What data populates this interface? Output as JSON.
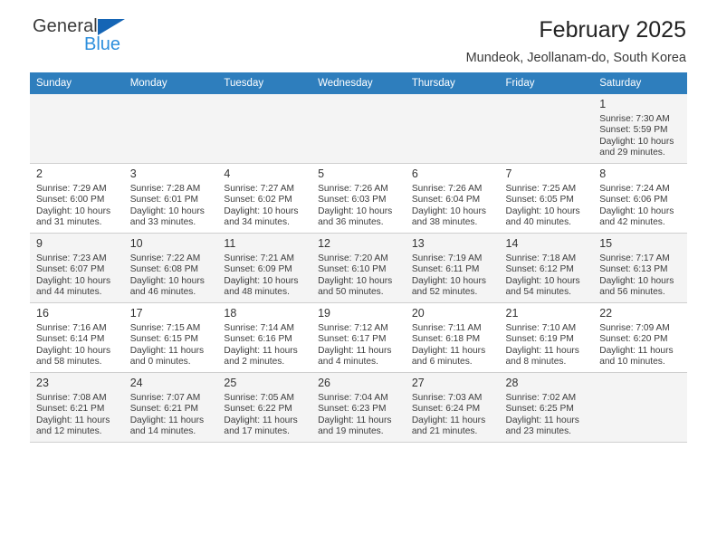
{
  "brand": {
    "name_top": "General",
    "name_bottom": "Blue",
    "triangle_icon": "brand-triangle-icon",
    "color_dark": "#3a3a3a",
    "color_blue": "#2d8fdd",
    "color_triangle": "#1565b5"
  },
  "header": {
    "title": "February 2025",
    "subtitle": "Mundeok, Jeollanam-do, South Korea"
  },
  "theme": {
    "header_row_bg": "#2e7ebd",
    "header_row_text": "#ffffff",
    "shaded_row_bg": "#f4f4f4",
    "grid_line": "#cfcfcf"
  },
  "calendar": {
    "weekday_headers": [
      "Sunday",
      "Monday",
      "Tuesday",
      "Wednesday",
      "Thursday",
      "Friday",
      "Saturday"
    ],
    "weeks": [
      {
        "shaded": true,
        "days": [
          {
            "date": "",
            "info": "",
            "empty": true
          },
          {
            "date": "",
            "info": "",
            "empty": true
          },
          {
            "date": "",
            "info": "",
            "empty": true
          },
          {
            "date": "",
            "info": "",
            "empty": true
          },
          {
            "date": "",
            "info": "",
            "empty": true
          },
          {
            "date": "",
            "info": "",
            "empty": true
          },
          {
            "date": "1",
            "info": "Sunrise: 7:30 AM\nSunset: 5:59 PM\nDaylight: 10 hours\nand 29 minutes.",
            "empty": false
          }
        ]
      },
      {
        "shaded": false,
        "days": [
          {
            "date": "2",
            "info": "Sunrise: 7:29 AM\nSunset: 6:00 PM\nDaylight: 10 hours\nand 31 minutes.",
            "empty": false
          },
          {
            "date": "3",
            "info": "Sunrise: 7:28 AM\nSunset: 6:01 PM\nDaylight: 10 hours\nand 33 minutes.",
            "empty": false
          },
          {
            "date": "4",
            "info": "Sunrise: 7:27 AM\nSunset: 6:02 PM\nDaylight: 10 hours\nand 34 minutes.",
            "empty": false
          },
          {
            "date": "5",
            "info": "Sunrise: 7:26 AM\nSunset: 6:03 PM\nDaylight: 10 hours\nand 36 minutes.",
            "empty": false
          },
          {
            "date": "6",
            "info": "Sunrise: 7:26 AM\nSunset: 6:04 PM\nDaylight: 10 hours\nand 38 minutes.",
            "empty": false
          },
          {
            "date": "7",
            "info": "Sunrise: 7:25 AM\nSunset: 6:05 PM\nDaylight: 10 hours\nand 40 minutes.",
            "empty": false
          },
          {
            "date": "8",
            "info": "Sunrise: 7:24 AM\nSunset: 6:06 PM\nDaylight: 10 hours\nand 42 minutes.",
            "empty": false
          }
        ]
      },
      {
        "shaded": true,
        "days": [
          {
            "date": "9",
            "info": "Sunrise: 7:23 AM\nSunset: 6:07 PM\nDaylight: 10 hours\nand 44 minutes.",
            "empty": false
          },
          {
            "date": "10",
            "info": "Sunrise: 7:22 AM\nSunset: 6:08 PM\nDaylight: 10 hours\nand 46 minutes.",
            "empty": false
          },
          {
            "date": "11",
            "info": "Sunrise: 7:21 AM\nSunset: 6:09 PM\nDaylight: 10 hours\nand 48 minutes.",
            "empty": false
          },
          {
            "date": "12",
            "info": "Sunrise: 7:20 AM\nSunset: 6:10 PM\nDaylight: 10 hours\nand 50 minutes.",
            "empty": false
          },
          {
            "date": "13",
            "info": "Sunrise: 7:19 AM\nSunset: 6:11 PM\nDaylight: 10 hours\nand 52 minutes.",
            "empty": false
          },
          {
            "date": "14",
            "info": "Sunrise: 7:18 AM\nSunset: 6:12 PM\nDaylight: 10 hours\nand 54 minutes.",
            "empty": false
          },
          {
            "date": "15",
            "info": "Sunrise: 7:17 AM\nSunset: 6:13 PM\nDaylight: 10 hours\nand 56 minutes.",
            "empty": false
          }
        ]
      },
      {
        "shaded": false,
        "days": [
          {
            "date": "16",
            "info": "Sunrise: 7:16 AM\nSunset: 6:14 PM\nDaylight: 10 hours\nand 58 minutes.",
            "empty": false
          },
          {
            "date": "17",
            "info": "Sunrise: 7:15 AM\nSunset: 6:15 PM\nDaylight: 11 hours\nand 0 minutes.",
            "empty": false
          },
          {
            "date": "18",
            "info": "Sunrise: 7:14 AM\nSunset: 6:16 PM\nDaylight: 11 hours\nand 2 minutes.",
            "empty": false
          },
          {
            "date": "19",
            "info": "Sunrise: 7:12 AM\nSunset: 6:17 PM\nDaylight: 11 hours\nand 4 minutes.",
            "empty": false
          },
          {
            "date": "20",
            "info": "Sunrise: 7:11 AM\nSunset: 6:18 PM\nDaylight: 11 hours\nand 6 minutes.",
            "empty": false
          },
          {
            "date": "21",
            "info": "Sunrise: 7:10 AM\nSunset: 6:19 PM\nDaylight: 11 hours\nand 8 minutes.",
            "empty": false
          },
          {
            "date": "22",
            "info": "Sunrise: 7:09 AM\nSunset: 6:20 PM\nDaylight: 11 hours\nand 10 minutes.",
            "empty": false
          }
        ]
      },
      {
        "shaded": true,
        "days": [
          {
            "date": "23",
            "info": "Sunrise: 7:08 AM\nSunset: 6:21 PM\nDaylight: 11 hours\nand 12 minutes.",
            "empty": false
          },
          {
            "date": "24",
            "info": "Sunrise: 7:07 AM\nSunset: 6:21 PM\nDaylight: 11 hours\nand 14 minutes.",
            "empty": false
          },
          {
            "date": "25",
            "info": "Sunrise: 7:05 AM\nSunset: 6:22 PM\nDaylight: 11 hours\nand 17 minutes.",
            "empty": false
          },
          {
            "date": "26",
            "info": "Sunrise: 7:04 AM\nSunset: 6:23 PM\nDaylight: 11 hours\nand 19 minutes.",
            "empty": false
          },
          {
            "date": "27",
            "info": "Sunrise: 7:03 AM\nSunset: 6:24 PM\nDaylight: 11 hours\nand 21 minutes.",
            "empty": false
          },
          {
            "date": "28",
            "info": "Sunrise: 7:02 AM\nSunset: 6:25 PM\nDaylight: 11 hours\nand 23 minutes.",
            "empty": false
          },
          {
            "date": "",
            "info": "",
            "empty": true
          }
        ]
      }
    ]
  }
}
